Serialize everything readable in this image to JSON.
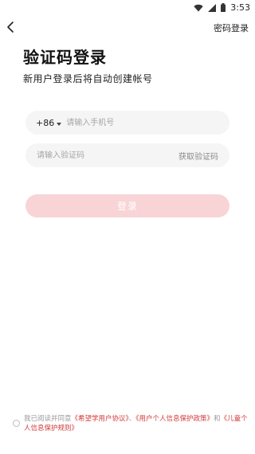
{
  "status_bar": {
    "time": "3:53",
    "icons": [
      "wifi-icon",
      "signal-icon",
      "battery-icon"
    ]
  },
  "header": {
    "back_icon": "chevron-left-icon",
    "password_login": "密码登录"
  },
  "main": {
    "title": "验证码登录",
    "subtitle": "新用户登录后将自动创建帐号",
    "phone": {
      "country_code": "+86",
      "placeholder": "请输入手机号",
      "value": ""
    },
    "code": {
      "placeholder": "请输入验证码",
      "value": "",
      "get_code_label": "获取验证码"
    },
    "login_button": "登录"
  },
  "agreement": {
    "prefix": "我已阅读并同意",
    "link1": "《希望学用户协议》",
    "sep1": "、",
    "link2": "《用户个人信息保护政策》",
    "sep2": "和",
    "link3": "《儿童个人信息保护规则》"
  },
  "colors": {
    "accent_disabled": "#f8d4d6",
    "link": "#d13a3a",
    "field_bg": "#f5f5f5"
  }
}
